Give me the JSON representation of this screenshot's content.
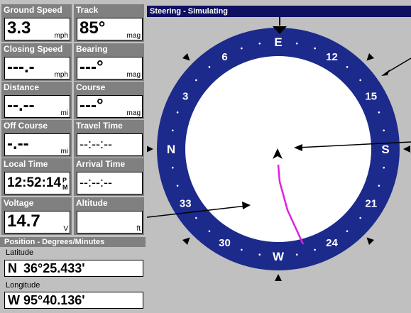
{
  "fields": [
    {
      "key": "ground_speed",
      "label": "Ground Speed",
      "value": "3.3",
      "unit": "mph"
    },
    {
      "key": "track",
      "label": "Track",
      "value": "85°",
      "unit": "mag"
    },
    {
      "key": "closing_speed",
      "label": "Closing Speed",
      "value": "---.-",
      "unit": "mph"
    },
    {
      "key": "bearing",
      "label": "Bearing",
      "value": "---°",
      "unit": "mag"
    },
    {
      "key": "distance",
      "label": "Distance",
      "value": "--.--",
      "unit": "mi"
    },
    {
      "key": "course",
      "label": "Course",
      "value": "---°",
      "unit": "mag"
    },
    {
      "key": "off_course",
      "label": "Off Course",
      "value": "-.--",
      "unit": "mi"
    },
    {
      "key": "travel_time",
      "label": "Travel Time",
      "value": "--:--:--",
      "unit": ""
    },
    {
      "key": "local_time",
      "label": "Local Time",
      "value": "12:52:14",
      "unit": "PM"
    },
    {
      "key": "arrival_time",
      "label": "Arrival Time",
      "value": "--:--:--",
      "unit": ""
    },
    {
      "key": "voltage",
      "label": "Voltage",
      "value": "14.7",
      "unit": "V"
    },
    {
      "key": "altitude",
      "label": "Altitude",
      "value": "",
      "unit": "ft"
    }
  ],
  "position": {
    "header": "Position - Degrees/Minutes",
    "latitude_label": "Latitude",
    "latitude_hem": "N",
    "latitude_value": "36°25.433'",
    "longitude_label": "Longitude",
    "longitude_hem": "W",
    "longitude_value": "95°40.136'"
  },
  "window_title": "Steering - Simulating",
  "compass": {
    "labels": [
      {
        "text": "E",
        "deg": 0
      },
      {
        "text": "12",
        "deg": 30
      },
      {
        "text": "15",
        "deg": 60
      },
      {
        "text": "S",
        "deg": 90
      },
      {
        "text": "21",
        "deg": 120
      },
      {
        "text": "24",
        "deg": 150
      },
      {
        "text": "W",
        "deg": 180
      },
      {
        "text": "30",
        "deg": 210
      },
      {
        "text": "33",
        "deg": 240
      },
      {
        "text": "N",
        "deg": 270
      },
      {
        "text": "3",
        "deg": 300
      },
      {
        "text": "6",
        "deg": 330
      }
    ],
    "ring_color": "#1c2a8c",
    "track_color": "#e020e0"
  }
}
